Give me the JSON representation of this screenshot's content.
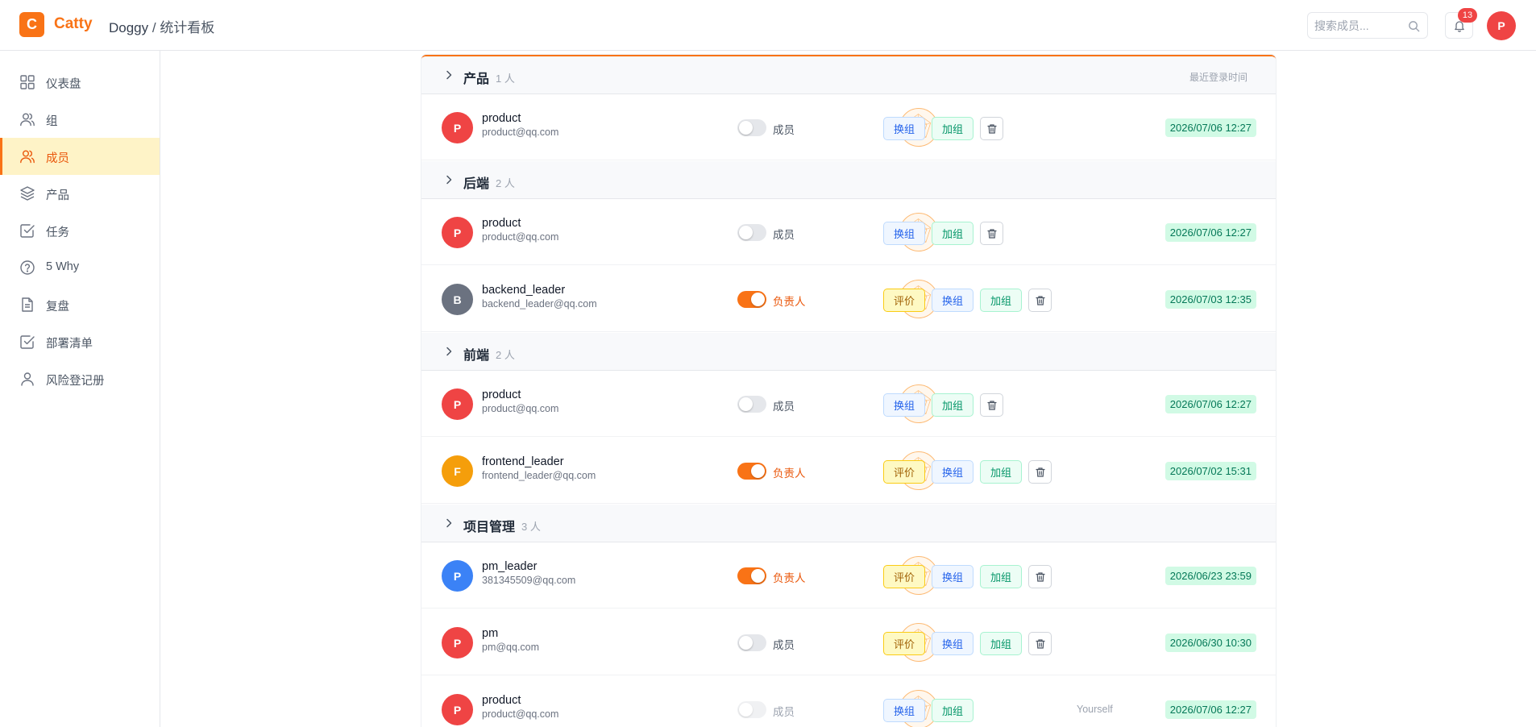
{
  "header": {
    "logo_letter": "C",
    "app_name": "Catty",
    "breadcrumb_root": "Doggy",
    "breadcrumb_sep": " / ",
    "breadcrumb_current": "统计看板",
    "search_placeholder": "搜索成员...",
    "notification_count": "13",
    "user_initial": "P"
  },
  "sidebar": {
    "items": [
      {
        "label": "仪表盘",
        "icon": "dashboard-icon"
      },
      {
        "label": "组",
        "icon": "users-icon"
      },
      {
        "label": "成员",
        "icon": "users-icon",
        "active": true
      },
      {
        "label": "产品",
        "icon": "layers-icon"
      },
      {
        "label": "任务",
        "icon": "checkbox-icon"
      },
      {
        "label": "5 Why",
        "icon": "help-circle-icon"
      },
      {
        "label": "复盘",
        "icon": "document-icon"
      },
      {
        "label": "部署清单",
        "icon": "checkbox-icon"
      },
      {
        "label": "风险登记册",
        "icon": "user-icon"
      }
    ]
  },
  "table": {
    "last_login_header": "最近登录时间",
    "groups": [
      {
        "name": "产品",
        "count": "1 人",
        "members": [
          {
            "initial": "P",
            "name": "product",
            "email": "product@qq.com",
            "role": "成员",
            "leader": false,
            "actions": [
              "换组",
              "加组"
            ],
            "deletable": true,
            "date": "2026/07/06 12:27",
            "color": "#ef4444"
          }
        ]
      },
      {
        "name": "后端",
        "count": "2 人",
        "members": [
          {
            "initial": "P",
            "name": "product",
            "email": "product@qq.com",
            "role": "成员",
            "leader": false,
            "actions": [
              "换组",
              "加组"
            ],
            "deletable": true,
            "date": "2026/07/06 12:27",
            "color": "#ef4444"
          },
          {
            "initial": "B",
            "name": "backend_leader",
            "email": "backend_leader@qq.com",
            "role": "负责人",
            "leader": true,
            "actions": [
              "评价",
              "换组",
              "加组"
            ],
            "deletable": true,
            "date": "2026/07/03 12:35",
            "color": "#6b7280"
          }
        ]
      },
      {
        "name": "前端",
        "count": "2 人",
        "members": [
          {
            "initial": "P",
            "name": "product",
            "email": "product@qq.com",
            "role": "成员",
            "leader": false,
            "actions": [
              "换组",
              "加组"
            ],
            "deletable": true,
            "date": "2026/07/06 12:27",
            "color": "#ef4444"
          },
          {
            "initial": "F",
            "name": "frontend_leader",
            "email": "frontend_leader@qq.com",
            "role": "负责人",
            "leader": true,
            "actions": [
              "评价",
              "换组",
              "加组"
            ],
            "deletable": true,
            "date": "2026/07/02 15:31",
            "color": "#f59e0b"
          }
        ]
      },
      {
        "name": "项目管理",
        "count": "3 人",
        "members": [
          {
            "initial": "P",
            "name": "pm_leader",
            "email": "381345509@qq.com",
            "role": "负责人",
            "leader": true,
            "actions": [
              "评价",
              "换组",
              "加组"
            ],
            "deletable": true,
            "date": "2026/06/23 23:59",
            "color": "#3b82f6"
          },
          {
            "initial": "P",
            "name": "pm",
            "email": "pm@qq.com",
            "role": "成员",
            "leader": false,
            "actions": [
              "评价",
              "换组",
              "加组"
            ],
            "deletable": true,
            "date": "2026/06/30 10:30",
            "color": "#ef4444"
          },
          {
            "initial": "P",
            "name": "product",
            "email": "product@qq.com",
            "role": "成员",
            "leader": false,
            "disabled": true,
            "actions": [
              "换组",
              "加组"
            ],
            "deletable": false,
            "note": "Yourself",
            "date": "2026/07/06 12:27",
            "color": "#ef4444"
          }
        ]
      }
    ]
  }
}
